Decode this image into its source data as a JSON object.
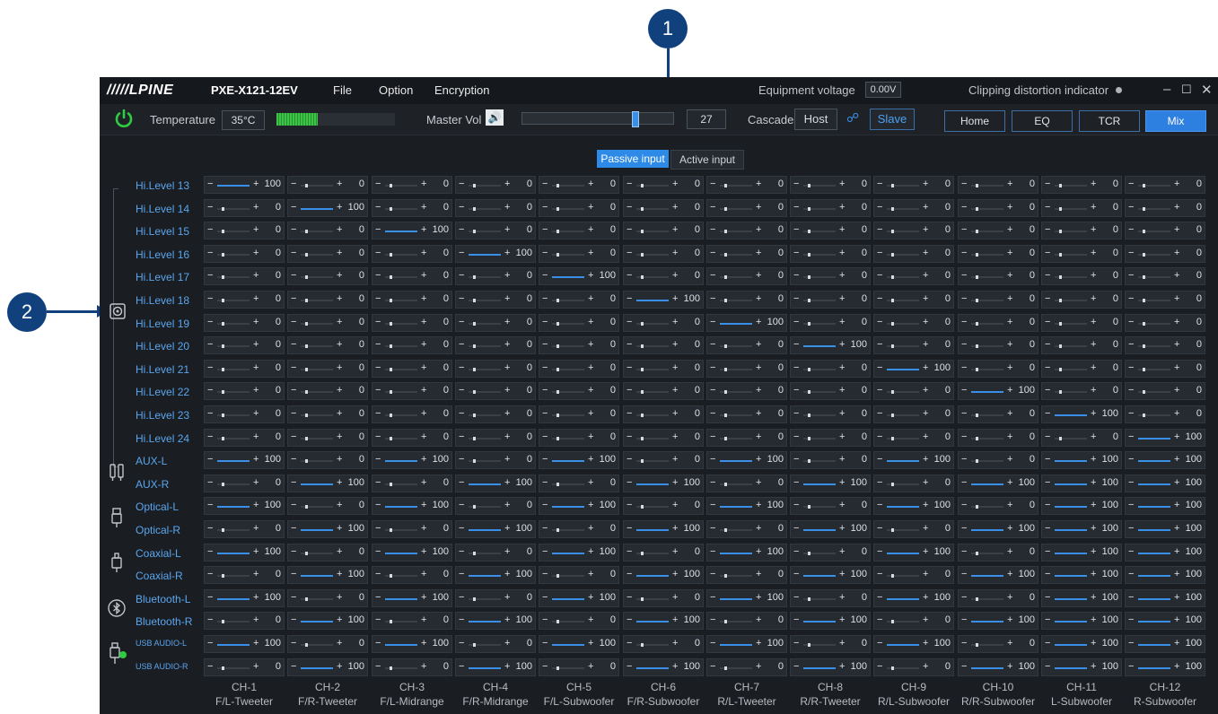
{
  "callouts": [
    "1",
    "2"
  ],
  "app": {
    "brand": "/////LPINE",
    "model": "PXE-X121-12EV",
    "menu": [
      "File",
      "Option",
      "Encryption"
    ],
    "equipment_voltage_label": "Equipment voltage",
    "equipment_voltage_value": "0.00V",
    "clipping_label": "Clipping distortion indicator",
    "window_controls": {
      "minimize": "–",
      "maximize": "☐",
      "close": "✕"
    }
  },
  "toolbar": {
    "temperature_label": "Temperature",
    "temperature_value": "35°C",
    "master_vol_label": "Master Vol",
    "master_vol_value": "27",
    "master_vol_fraction": 0.75,
    "cascade_label": "Cascade",
    "host_label": "Host",
    "slave_label": "Slave",
    "nav": [
      "Home",
      "EQ",
      "TCR",
      "Mix"
    ],
    "nav_active": "Mix",
    "accent": "#2d8ae6"
  },
  "tabs": {
    "passive": "Passive input",
    "active": "Active input",
    "selected": "Passive input"
  },
  "sources": [
    "Hi.Level 13",
    "Hi.Level 14",
    "Hi.Level 15",
    "Hi.Level 16",
    "Hi.Level 17",
    "Hi.Level 18",
    "Hi.Level 19",
    "Hi.Level 20",
    "Hi.Level 21",
    "Hi.Level 22",
    "Hi.Level 23",
    "Hi.Level 24",
    "AUX-L",
    "AUX-R",
    "Optical-L",
    "Optical-R",
    "Coaxial-L",
    "Coaxial-R",
    "Bluetooth-L",
    "Bluetooth-R",
    "USB AUDIO-L",
    "USB AUDIO-R"
  ],
  "source_icons": [
    "speaker-icon",
    "rca-plug-icon",
    "optical-plug-icon",
    "coaxial-plug-icon",
    "bluetooth-icon",
    "usb-plug-icon"
  ],
  "channels": [
    {
      "ch": "CH-1",
      "name": "F/L-Tweeter"
    },
    {
      "ch": "CH-2",
      "name": "F/R-Tweeter"
    },
    {
      "ch": "CH-3",
      "name": "F/L-Midrange"
    },
    {
      "ch": "CH-4",
      "name": "F/R-Midrange"
    },
    {
      "ch": "CH-5",
      "name": "F/L-Subwoofer"
    },
    {
      "ch": "CH-6",
      "name": "F/R-Subwoofer"
    },
    {
      "ch": "CH-7",
      "name": "R/L-Tweeter"
    },
    {
      "ch": "CH-8",
      "name": "R/R-Tweeter"
    },
    {
      "ch": "CH-9",
      "name": "R/L-Subwoofer"
    },
    {
      "ch": "CH-10",
      "name": "R/R-Subwoofer"
    },
    {
      "ch": "CH-11",
      "name": "L-Subwoofer"
    },
    {
      "ch": "CH-12",
      "name": "R-Subwoofer"
    }
  ],
  "matrix": [
    [
      100,
      0,
      0,
      0,
      0,
      0,
      0,
      0,
      0,
      0,
      0,
      0
    ],
    [
      0,
      100,
      0,
      0,
      0,
      0,
      0,
      0,
      0,
      0,
      0,
      0
    ],
    [
      0,
      0,
      100,
      0,
      0,
      0,
      0,
      0,
      0,
      0,
      0,
      0
    ],
    [
      0,
      0,
      0,
      100,
      0,
      0,
      0,
      0,
      0,
      0,
      0,
      0
    ],
    [
      0,
      0,
      0,
      0,
      100,
      0,
      0,
      0,
      0,
      0,
      0,
      0
    ],
    [
      0,
      0,
      0,
      0,
      0,
      100,
      0,
      0,
      0,
      0,
      0,
      0
    ],
    [
      0,
      0,
      0,
      0,
      0,
      0,
      100,
      0,
      0,
      0,
      0,
      0
    ],
    [
      0,
      0,
      0,
      0,
      0,
      0,
      0,
      100,
      0,
      0,
      0,
      0
    ],
    [
      0,
      0,
      0,
      0,
      0,
      0,
      0,
      0,
      100,
      0,
      0,
      0
    ],
    [
      0,
      0,
      0,
      0,
      0,
      0,
      0,
      0,
      0,
      100,
      0,
      0
    ],
    [
      0,
      0,
      0,
      0,
      0,
      0,
      0,
      0,
      0,
      0,
      100,
      0
    ],
    [
      0,
      0,
      0,
      0,
      0,
      0,
      0,
      0,
      0,
      0,
      0,
      100
    ],
    [
      100,
      0,
      100,
      0,
      100,
      0,
      100,
      0,
      100,
      0,
      100,
      100
    ],
    [
      0,
      100,
      0,
      100,
      0,
      100,
      0,
      100,
      0,
      100,
      100,
      100
    ],
    [
      100,
      0,
      100,
      0,
      100,
      0,
      100,
      0,
      100,
      0,
      100,
      100
    ],
    [
      0,
      100,
      0,
      100,
      0,
      100,
      0,
      100,
      0,
      100,
      100,
      100
    ],
    [
      100,
      0,
      100,
      0,
      100,
      0,
      100,
      0,
      100,
      0,
      100,
      100
    ],
    [
      0,
      100,
      0,
      100,
      0,
      100,
      0,
      100,
      0,
      100,
      100,
      100
    ],
    [
      100,
      0,
      100,
      0,
      100,
      0,
      100,
      0,
      100,
      0,
      100,
      100
    ],
    [
      0,
      100,
      0,
      100,
      0,
      100,
      0,
      100,
      0,
      100,
      100,
      100
    ],
    [
      100,
      0,
      100,
      0,
      100,
      0,
      100,
      0,
      100,
      0,
      100,
      100
    ],
    [
      0,
      100,
      0,
      100,
      0,
      100,
      0,
      100,
      0,
      100,
      100,
      100
    ]
  ]
}
